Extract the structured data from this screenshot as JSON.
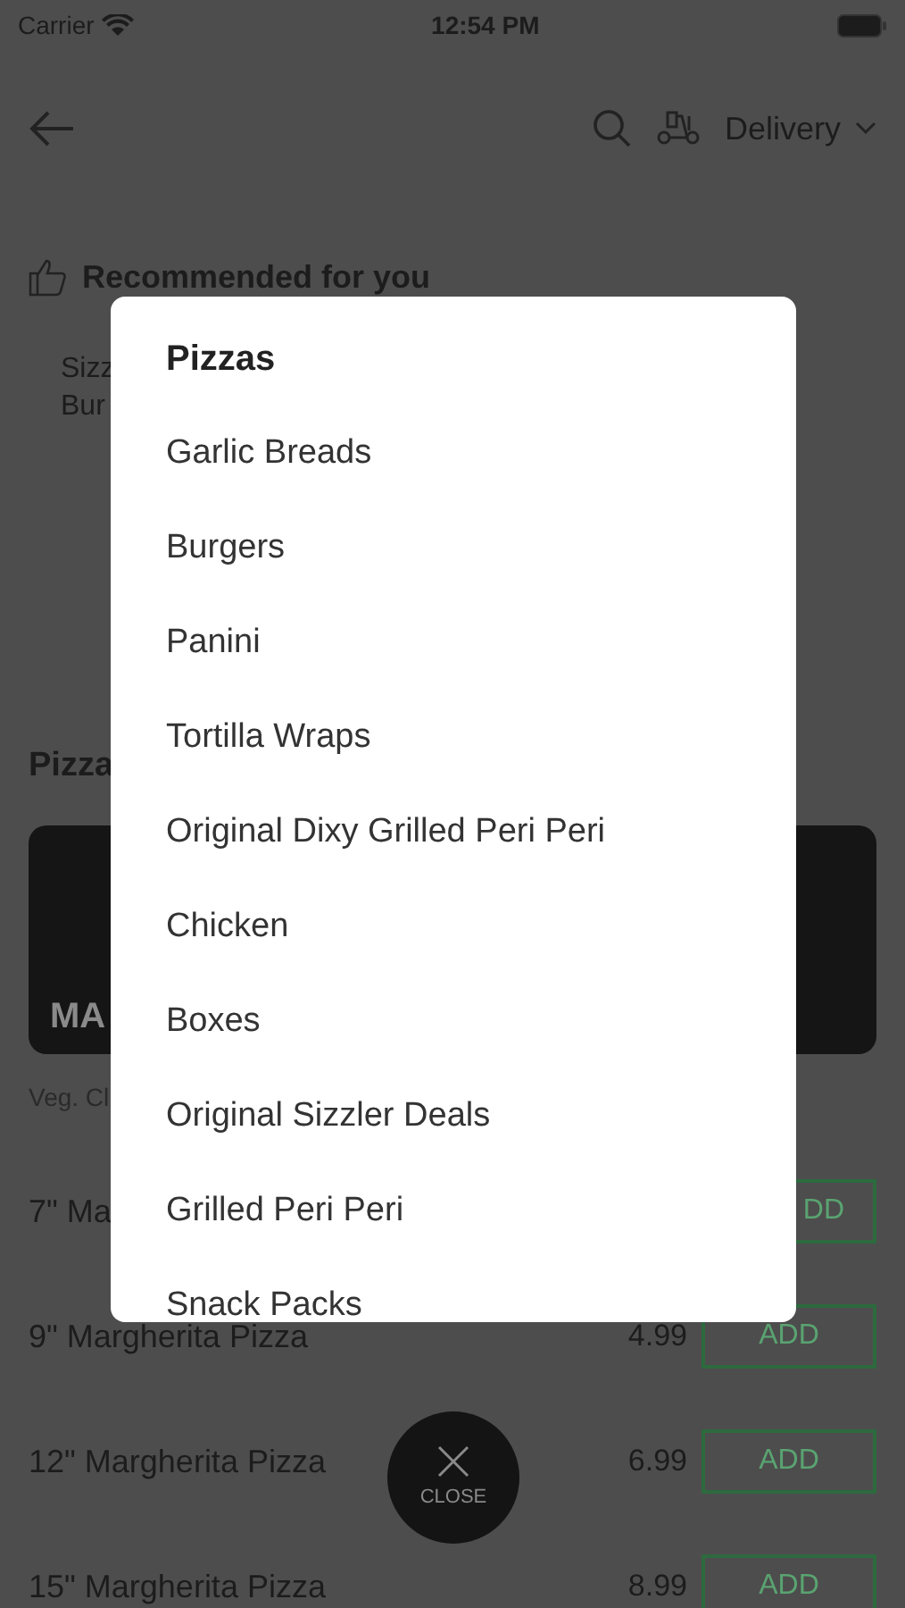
{
  "status_bar": {
    "carrier": "Carrier",
    "time": "12:54 PM"
  },
  "header": {
    "mode": "Delivery"
  },
  "recommended": {
    "title": "Recommended for you",
    "lines": [
      "Sizz",
      "Bur"
    ]
  },
  "section": {
    "title": "Pizza",
    "banner_text": "MA",
    "description": "Veg. Cl"
  },
  "items": [
    {
      "name": "7\" Ma",
      "button": "DD"
    },
    {
      "name": "9\" Margherita Pizza",
      "price": "4.99",
      "button": "ADD"
    },
    {
      "name": "12\" Margherita Pizza",
      "price": "6.99",
      "button": "ADD"
    },
    {
      "name": "15\" Margherita Pizza",
      "price": "8.99",
      "button": "ADD"
    }
  ],
  "category_menu": [
    {
      "label": "Pizzas",
      "selected": true
    },
    {
      "label": "Garlic Breads",
      "selected": false
    },
    {
      "label": "Burgers",
      "selected": false
    },
    {
      "label": "Panini",
      "selected": false
    },
    {
      "label": "Tortilla Wraps",
      "selected": false
    },
    {
      "label": "Original Dixy Grilled Peri Peri",
      "selected": false
    },
    {
      "label": "Chicken",
      "selected": false
    },
    {
      "label": "Boxes",
      "selected": false
    },
    {
      "label": "Original Sizzler Deals",
      "selected": false
    },
    {
      "label": "Grilled Peri Peri",
      "selected": false
    },
    {
      "label": "Snack Packs",
      "selected": false
    }
  ],
  "close_button": {
    "label": "CLOSE"
  }
}
